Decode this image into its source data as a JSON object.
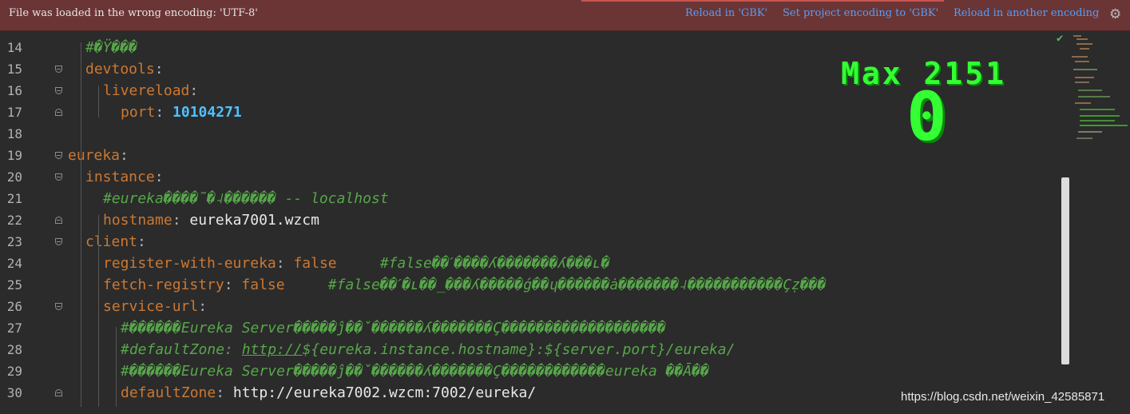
{
  "notification": {
    "message": "File was loaded in the wrong encoding: 'UTF-8'",
    "actions": [
      "Reload in 'GBK'",
      "Set project encoding to 'GBK'",
      "Reload in another encoding"
    ]
  },
  "editor": {
    "lines": [
      {
        "num": "14",
        "tokens": [
          {
            "t": "#�Ÿ���",
            "c": "c"
          }
        ]
      },
      {
        "num": "15",
        "tokens": [
          {
            "t": "devtools",
            "c": "k"
          },
          {
            "t": ":",
            "c": "p"
          }
        ]
      },
      {
        "num": "16",
        "tokens": [
          {
            "t": "livereload",
            "c": "k"
          },
          {
            "t": ":",
            "c": "p"
          }
        ]
      },
      {
        "num": "17",
        "tokens": [
          {
            "t": "port",
            "c": "k"
          },
          {
            "t": ": ",
            "c": "p"
          },
          {
            "t": "10104271",
            "c": "n"
          }
        ]
      },
      {
        "num": "18",
        "tokens": []
      },
      {
        "num": "19",
        "tokens": [
          {
            "t": "eureka",
            "c": "k"
          },
          {
            "t": ":",
            "c": "p"
          }
        ]
      },
      {
        "num": "20",
        "tokens": [
          {
            "t": "instance",
            "c": "k"
          },
          {
            "t": ":",
            "c": "p"
          }
        ]
      },
      {
        "num": "21",
        "tokens": [
          {
            "t": "#eureka����˜�˨������ -- localhost",
            "c": "c"
          }
        ]
      },
      {
        "num": "22",
        "tokens": [
          {
            "t": "hostname",
            "c": "k"
          },
          {
            "t": ": ",
            "c": "p"
          },
          {
            "t": "eureka7001.wzcm",
            "c": "v"
          }
        ]
      },
      {
        "num": "23",
        "tokens": [
          {
            "t": "client",
            "c": "k"
          },
          {
            "t": ":",
            "c": "p"
          }
        ]
      },
      {
        "num": "24",
        "tokens": [
          {
            "t": "register-with-eureka",
            "c": "k"
          },
          {
            "t": ": ",
            "c": "p"
          },
          {
            "t": "false",
            "c": "k"
          },
          {
            "t": "     ",
            "c": "p"
          },
          {
            "t": "#false��ˊ����ʎ�������ʎ���ʟ�",
            "c": "c"
          }
        ]
      },
      {
        "num": "25",
        "tokens": [
          {
            "t": "fetch-registry",
            "c": "k"
          },
          {
            "t": ": ",
            "c": "p"
          },
          {
            "t": "false",
            "c": "k"
          },
          {
            "t": "     ",
            "c": "p"
          },
          {
            "t": "#false��ˊ�ʟ��_���ʎ�����ǵ��ɥ������ȧ�������˨�����������Çẓ���",
            "c": "c"
          }
        ]
      },
      {
        "num": "26",
        "tokens": [
          {
            "t": "service-url",
            "c": "k"
          },
          {
            "t": ":",
            "c": "p"
          }
        ]
      },
      {
        "num": "27",
        "tokens": [
          {
            "t": "#������Eureka Server�����ĵ��ˇ������ʎ�������Ç�������������������",
            "c": "c"
          }
        ]
      },
      {
        "num": "28",
        "tokens": [
          {
            "t": "#defaultZone: ",
            "c": "c"
          },
          {
            "t": "http://",
            "c": "c u"
          },
          {
            "t": "${eureka.instance.hostname}:${server.port}/eureka/",
            "c": "c"
          }
        ]
      },
      {
        "num": "29",
        "tokens": [
          {
            "t": "#������Eureka Server�����ĵ��ˇ������ʎ�������Ç������������eureka ��Ā��",
            "c": "c"
          }
        ]
      },
      {
        "num": "30",
        "tokens": [
          {
            "t": "defaultZone",
            "c": "k"
          },
          {
            "t": ": ",
            "c": "p"
          },
          {
            "t": "http://eureka7002.wzcm:7002/eureka/",
            "c": "v"
          }
        ]
      }
    ]
  },
  "overlay": {
    "max_label": "Max 2151",
    "counter": "0"
  },
  "icons": {
    "settings": "gear-icon",
    "inspection_ok": "check-icon",
    "fold_markers": "fold-icon"
  },
  "watermark": "https://blog.csdn.net/weixin_42585871",
  "colors": {
    "bar_bg": "#6b3535",
    "link": "#589df6",
    "key": "#cc7832",
    "number": "#4fc1ff",
    "comment": "#57a64a",
    "overlay_green": "#33ff33"
  }
}
